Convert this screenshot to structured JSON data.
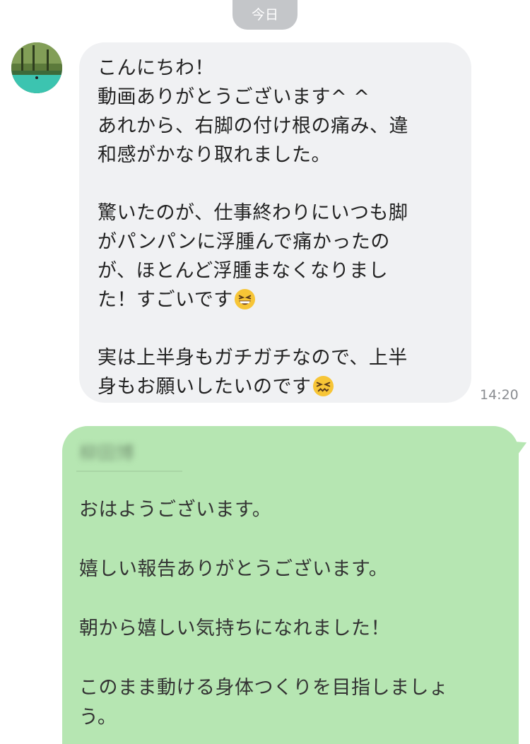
{
  "date_label": "今日",
  "incoming": {
    "text_main": "こんにちわ！\n動画ありがとうございます^ ^\nあれから、右脚の付け根の痛み、違\n和感がかなり取れました。\n\n驚いたのが、仕事終わりにいつも脚\nがパンパンに浮腫んで痛かったの\nが、ほとんど浮腫まなくなりまし\nた！すごいです",
    "emoji_1": "grinning-squinting-face-emoji",
    "text_end": "\n\n実は上半身もガチガチなので、上半\n身もお願いしたいのです",
    "emoji_2": "persevering-face-emoji",
    "time": "14:20"
  },
  "outgoing": {
    "sender_name_blurred": "柳田博",
    "text": "おはようございます。\n\n嬉しい報告ありがとうございます。\n\n朝から嬉しい気持ちになれました！\n\nこのまま動ける身体つくりを目指しましょ\nう。"
  },
  "colors": {
    "incoming_bubble": "#f0f1f3",
    "outgoing_bubble": "#b6e6b2",
    "date_pill": "#c4c6c9",
    "timestamp": "#8a8d91"
  }
}
